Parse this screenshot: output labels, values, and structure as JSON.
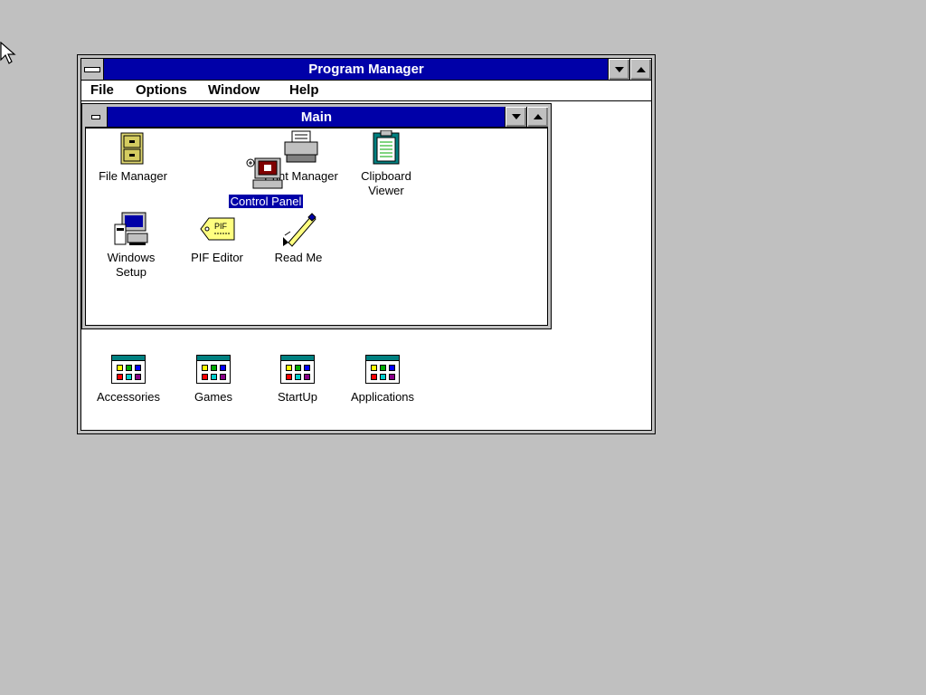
{
  "program_manager": {
    "title": "Program Manager",
    "menu": [
      "File",
      "Options",
      "Window",
      "Help"
    ]
  },
  "main_group": {
    "title": "Main",
    "icons": [
      {
        "label": "File Manager",
        "icon": "file-cabinet-icon"
      },
      {
        "label": "Print Manager",
        "icon": "printer-icon"
      },
      {
        "label": "Clipboard Viewer",
        "icon": "clipboard-icon"
      },
      {
        "label": "Control Panel",
        "icon": "control-panel-icon",
        "selected": true
      },
      {
        "label": "Windows Setup",
        "icon": "computer-setup-icon"
      },
      {
        "label": "PIF Editor",
        "icon": "pif-tag-icon"
      },
      {
        "label": "Read Me",
        "icon": "pen-readme-icon"
      }
    ]
  },
  "groups": [
    {
      "label": "Accessories"
    },
    {
      "label": "Games"
    },
    {
      "label": "StartUp"
    },
    {
      "label": "Applications"
    }
  ],
  "colors": {
    "desktop": "#c0c0c0",
    "title_active": "#0000a8",
    "window_bg": "#ffffff"
  }
}
